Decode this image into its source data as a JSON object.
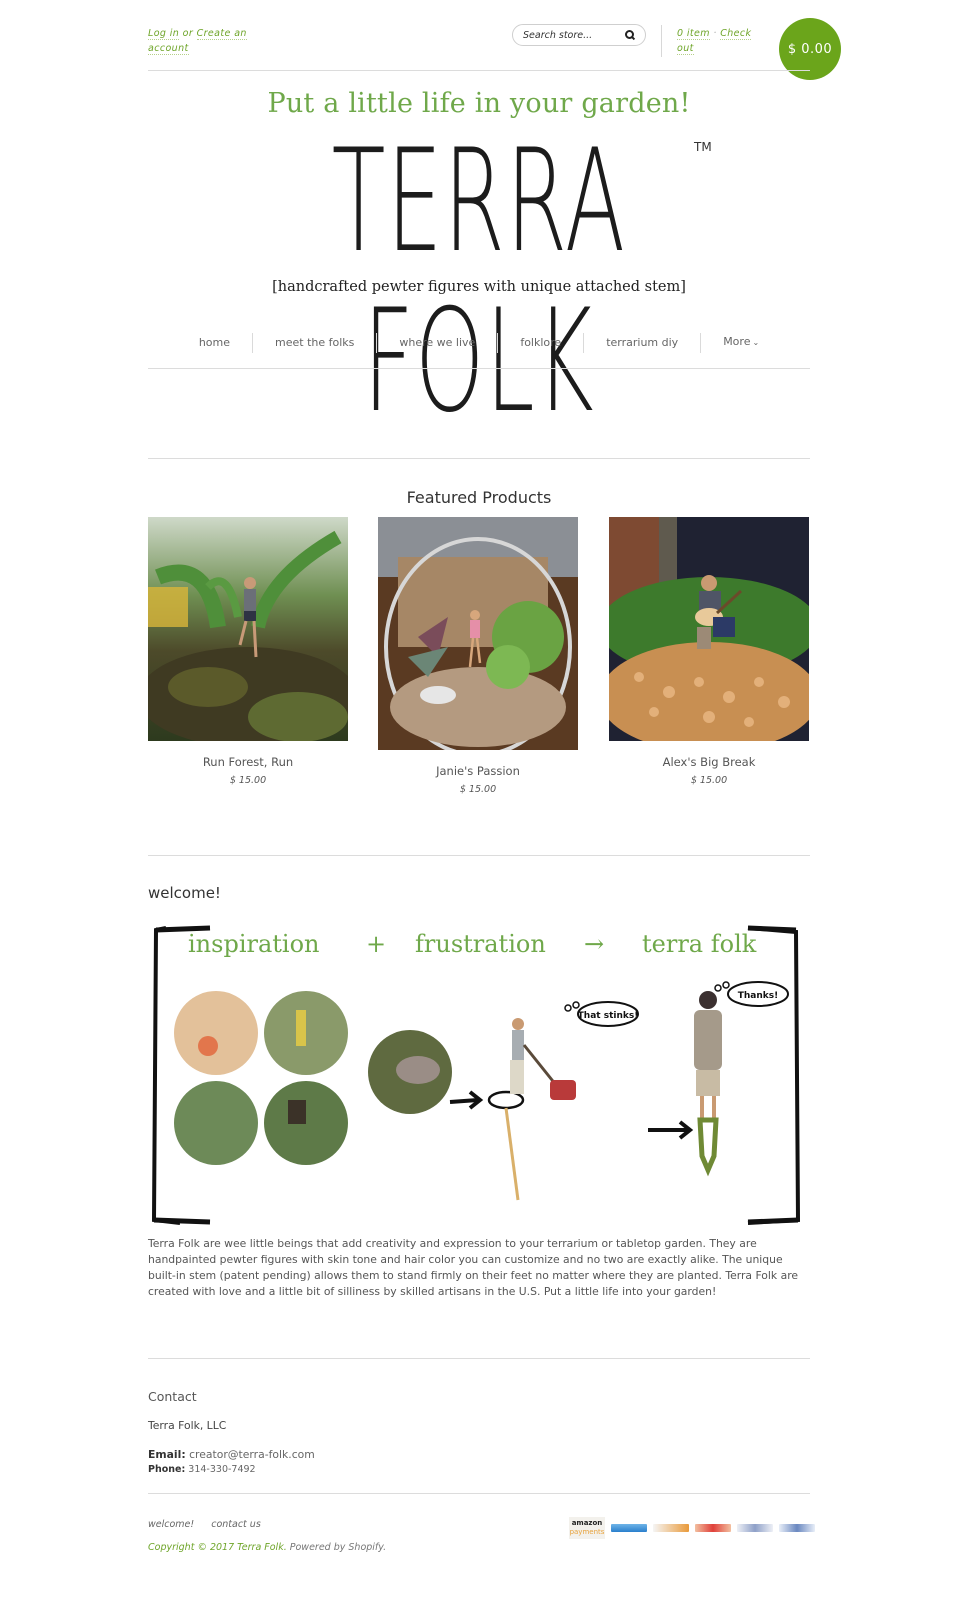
{
  "header": {
    "login_text": "Log in",
    "or_text": "or",
    "create_account_text": "Create an account",
    "search_placeholder": "Search store...",
    "cart_items": "0 item",
    "cart_separator": "·",
    "checkout_text": "Check out",
    "cart_total": "$ 0.00"
  },
  "logo": {
    "tagline": "Put a little life in your garden!",
    "brand": "TERRA FOLK",
    "trademark": "TM",
    "subline": "[handcrafted pewter figures with unique attached stem]"
  },
  "nav": {
    "items": [
      {
        "label": "home"
      },
      {
        "label": "meet the folks"
      },
      {
        "label": "where we live"
      },
      {
        "label": "folklore"
      },
      {
        "label": "terrarium diy"
      },
      {
        "label": "More"
      }
    ]
  },
  "featured": {
    "title": "Featured Products",
    "products": [
      {
        "name": "Run Forest, Run",
        "price": "$ 15.00",
        "image_desc": "runner-figure-in-moss"
      },
      {
        "name": "Janie's Passion",
        "price": "$ 15.00",
        "image_desc": "figure-in-glass-terrarium"
      },
      {
        "name": "Alex's Big Break",
        "price": "$ 15.00",
        "image_desc": "guitar-player-figure"
      }
    ]
  },
  "welcome": {
    "title": "welcome!",
    "banner": {
      "word1": "inspiration",
      "plus": "+",
      "word2": "frustration",
      "arrow": "→",
      "word3": "terra folk",
      "bubble1": "That stinks!",
      "bubble2": "Thanks!"
    },
    "body": "Terra Folk are wee little beings that add creativity and expression to your terrarium or tabletop garden. They are handpainted pewter figures with skin tone and hair color you can customize and no two are exactly alike. The unique built-in stem (patent pending) allows them to stand firmly on their feet no matter where they are planted. Terra Folk are created with love and a little bit of silliness by skilled artisans in the U.S. Put a little life into your garden!"
  },
  "contact": {
    "title": "Contact",
    "company": "Terra Folk, LLC",
    "email_label": "Email:",
    "email": "creator@terra-folk.com",
    "phone_label": "Phone:",
    "phone": "314-330-7492"
  },
  "footer": {
    "links": [
      {
        "label": "welcome!"
      },
      {
        "label": "contact us"
      }
    ],
    "copyright": "Copyright © 2017 Terra Folk.",
    "powered": "Powered by Shopify.",
    "payment_amazon_top": "amazon",
    "payment_amazon_bottom": "payments"
  },
  "colors": {
    "accent_green": "#6ba51b",
    "link_green": "#6fa52a",
    "tagline_green": "#6fa84a"
  }
}
